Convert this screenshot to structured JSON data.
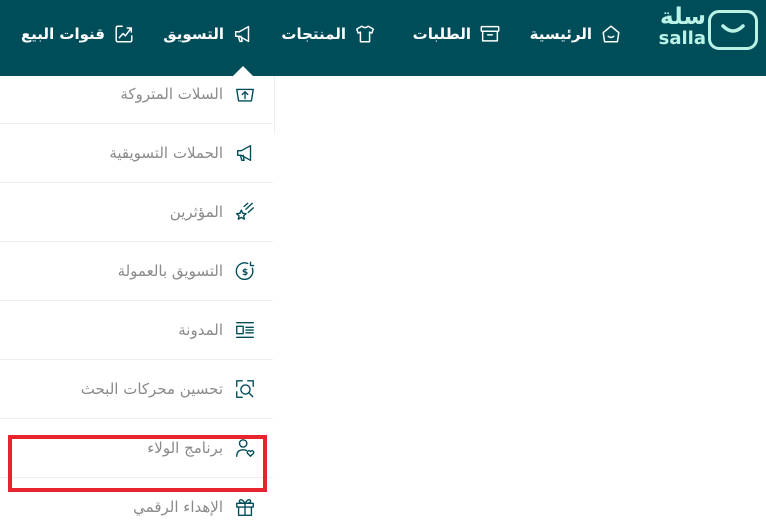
{
  "brand": {
    "name_ar": "سلة",
    "name_en": "salla",
    "logo_icon": "salla-bag-logo",
    "color_primary": "#004d5a",
    "color_logo": "#baf3e6",
    "highlight_color": "#e8232d"
  },
  "nav": {
    "items": [
      {
        "label": "الرئيسية",
        "icon": "home-icon"
      },
      {
        "label": "الطلبات",
        "icon": "orders-box-icon"
      },
      {
        "label": "المنتجات",
        "icon": "tshirt-icon"
      },
      {
        "label": "التسويق",
        "icon": "megaphone-icon",
        "active": true
      },
      {
        "label": "قنوات البيع",
        "icon": "sales-channels-icon"
      }
    ]
  },
  "dropdown": {
    "items": [
      {
        "label": "السلات المتروكة",
        "icon": "abandoned-cart-icon"
      },
      {
        "label": "الحملات التسويقية",
        "icon": "megaphone-icon"
      },
      {
        "label": "المؤثرين",
        "icon": "shooting-star-icon"
      },
      {
        "label": "التسويق بالعمولة",
        "icon": "affiliate-coin-icon"
      },
      {
        "label": "المدونة",
        "icon": "blog-icon"
      },
      {
        "label": "تحسين محركات البحث",
        "icon": "seo-search-icon",
        "highlighted": true
      },
      {
        "label": "برنامج الولاء",
        "icon": "loyalty-user-heart-icon"
      },
      {
        "label": "الإهداء الرقمي",
        "icon": "gift-icon"
      }
    ]
  }
}
